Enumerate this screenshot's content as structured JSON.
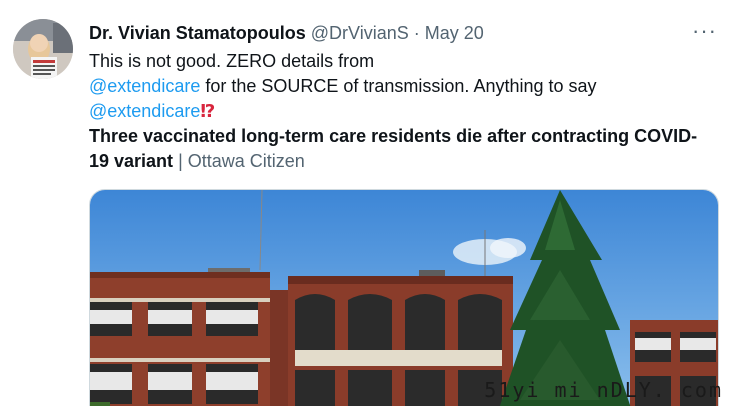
{
  "tweet": {
    "display_name": "Dr. Vivian Stamatopoulos",
    "handle": "@DrVivianS",
    "separator": "·",
    "date": "May 20",
    "more_label": "···",
    "text_line1": "This is not good. ZERO details from",
    "mention1": "@extendicare",
    "text_line2_rest": " for the SOURCE of transmission. Anything to say",
    "mention2": "@extendicare",
    "emoji": "⁉",
    "headline": "Three vaccinated long-term care residents die after contracting COVID-19 variant",
    "headline_sep": " | ",
    "source": "Ottawa Citizen"
  },
  "watermark": "51yi mi nDLY. com",
  "colors": {
    "link": "#1d9bf0",
    "secondary_text": "#536471",
    "primary_text": "#0f1419"
  }
}
